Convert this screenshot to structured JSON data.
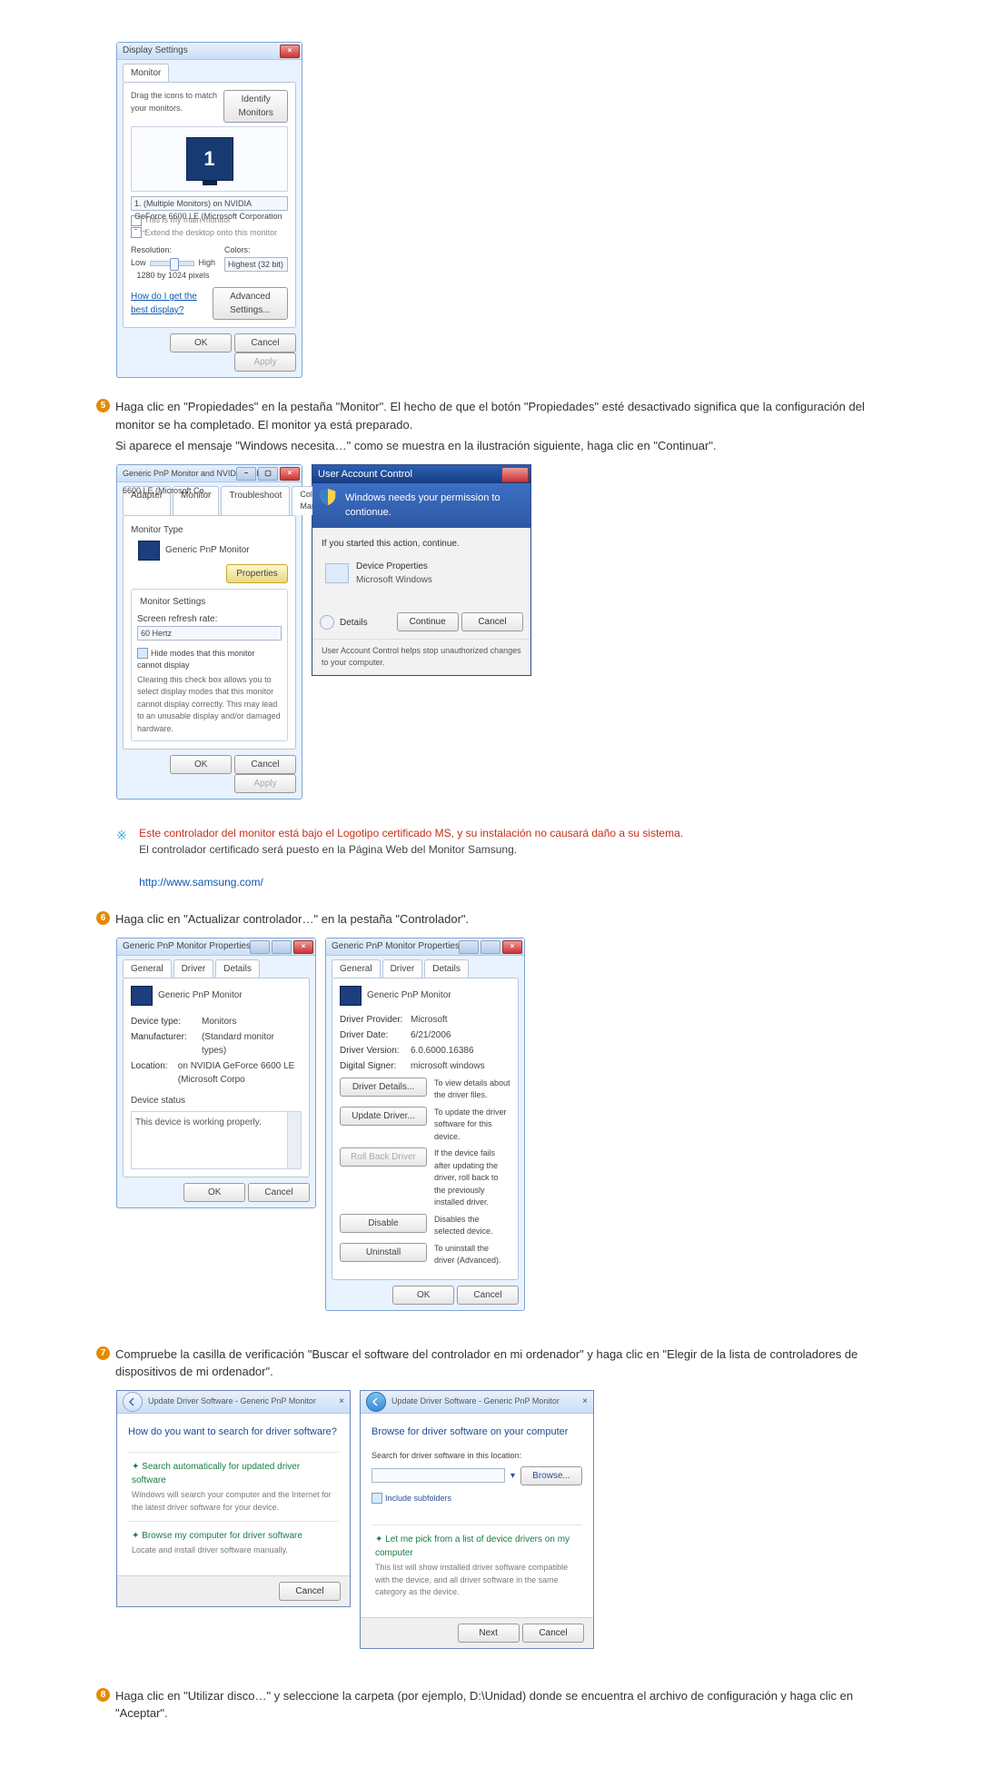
{
  "figA": {
    "title": "Display Settings",
    "tab": "Monitor",
    "drag": "Drag the icons to match your monitors.",
    "identify": "Identify Monitors",
    "monitor_number": "1",
    "picklist": "1. (Multiple Monitors) on NVIDIA GeForce 6600 LE (Microsoft Corporation - …",
    "chk_main": "This is my main monitor",
    "chk_extend": "Extend the desktop onto this monitor",
    "res_label": "Resolution:",
    "res_low": "Low",
    "res_high": "High",
    "res_value": "1280 by 1024 pixels",
    "colors_label": "Colors:",
    "colors_value": "Highest (32 bit)",
    "best": "How do I get the best display?",
    "adv": "Advanced Settings...",
    "ok": "OK",
    "cancel": "Cancel",
    "apply": "Apply"
  },
  "step5": {
    "num": "5",
    "p1": "Haga clic en \"Propiedades\" en la pestaña \"Monitor\". El hecho de que el botón \"Propiedades\" esté desactivado significa que la configuración del monitor se ha completado. El monitor ya está preparado.",
    "p2": "Si aparece el mensaje \"Windows necesita…\" como se muestra en la ilustración siguiente, haga clic en  \"Continuar\"."
  },
  "figB": {
    "title": "Generic PnP Monitor and NVIDIA GeForce 6600 LE (Microsoft Co…",
    "tabs": [
      "Adapter",
      "Monitor",
      "Troubleshoot",
      "Color Management"
    ],
    "mtype": "Monitor Type",
    "mname": "Generic PnP Monitor",
    "properties": "Properties",
    "msettings": "Monitor Settings",
    "refresh": "Screen refresh rate:",
    "refresh_value": "60 Hertz",
    "hide": "Hide modes that this monitor cannot display",
    "hide_desc": "Clearing this check box allows you to select display modes that this monitor cannot display correctly. This may lead to an unusable display and/or damaged hardware.",
    "ok": "OK",
    "cancel": "Cancel",
    "apply": "Apply"
  },
  "uac": {
    "title": "User Account Control",
    "banner": "Windows needs your permission to contionue.",
    "started": "If you started this action, continue.",
    "dp": "Device Properties",
    "mw": "Microsoft Windows",
    "details": "Details",
    "continue": "Continue",
    "cancel": "Cancel",
    "footer": "User Account Control helps stop unauthorized changes to your computer."
  },
  "note": {
    "l1": "Este controlador del monitor está bajo el Logotipo certificado MS, y su instalación no causará daño a su sistema.",
    "l2": "El controlador certificado será puesto en la Página Web del Monitor Samsung.",
    "url": "http://www.samsung.com/"
  },
  "step6": {
    "num": "6",
    "p1": "Haga clic en \"Actualizar controlador…\" en la pestaña \"Controlador\"."
  },
  "figD": {
    "title": "Generic PnP Monitor Properties",
    "tabs": [
      "General",
      "Driver",
      "Details"
    ],
    "name": "Generic PnP Monitor",
    "dt": "Device type:",
    "dtv": "Monitors",
    "mf": "Manufacturer:",
    "mfv": "(Standard monitor types)",
    "loc": "Location:",
    "locv": "on NVIDIA GeForce 6600 LE (Microsoft Corpo",
    "ds": "Device status",
    "dsv": "This device is working properly.",
    "ok": "OK",
    "cancel": "Cancel"
  },
  "figE": {
    "title": "Generic PnP Monitor Properties",
    "tabs": [
      "General",
      "Driver",
      "Details"
    ],
    "name": "Generic PnP Monitor",
    "dp": "Driver Provider:",
    "dpv": "Microsoft",
    "dd": "Driver Date:",
    "ddv": "6/21/2006",
    "dv": "Driver Version:",
    "dvv": "6.0.6000.16386",
    "dsig": "Digital Signer:",
    "dsigv": "microsoft windows",
    "bDetails": "Driver Details...",
    "cDetails": "To view details about the driver files.",
    "bUpdate": "Update Driver...",
    "cUpdate": "To update the driver software for this device.",
    "bRoll": "Roll Back Driver",
    "cRoll": "If the device fails after updating the driver, roll back to the previously installed driver.",
    "bDisable": "Disable",
    "cDisable": "Disables the selected device.",
    "bUninstall": "Uninstall",
    "cUninstall": "To uninstall the driver (Advanced).",
    "ok": "OK",
    "cancel": "Cancel"
  },
  "step7": {
    "num": "7",
    "p1": "Compruebe la casilla de verificación \"Buscar el software del controlador en mi ordenador\" y haga clic en \"Elegir de la lista de controladores de dispositivos de mi ordenador\"."
  },
  "wizA": {
    "bread": "Update Driver Software - Generic PnP Monitor",
    "h": "How do you want to search for driver software?",
    "o1t": "Search automatically for updated driver software",
    "o1d": "Windows will search your computer and the Internet for the latest driver software for your device.",
    "o2t": "Browse my computer for driver software",
    "o2d": "Locate and install driver software manually.",
    "cancel": "Cancel"
  },
  "wizB": {
    "bread": "Update Driver Software - Generic PnP Monitor",
    "h": "Browse for driver software on your computer",
    "search": "Search for driver software in this location:",
    "browse": "Browse...",
    "include": "Include subfolders",
    "o1t": "Let me pick from a list of device drivers on my computer",
    "o1d": "This list will show installed driver software compatible with the device, and all driver software in the same category as the device.",
    "next": "Next",
    "cancel": "Cancel"
  },
  "step8": {
    "num": "8",
    "p1": "Haga clic en \"Utilizar disco…\" y seleccione la carpeta (por ejemplo, D:\\Unidad) donde se encuentra el archivo de configuración y haga clic en \"Aceptar\"."
  }
}
